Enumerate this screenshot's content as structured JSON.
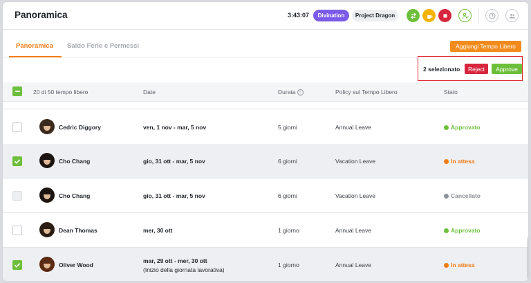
{
  "header": {
    "title": "Panoramica",
    "timer": "3:43:07",
    "pill_activity": "Divination",
    "pill_project": "Project Dragon",
    "icons": [
      "swap-icon",
      "coffee-icon",
      "stop-icon",
      "user-check-icon",
      "help-icon",
      "team-icon"
    ]
  },
  "tabs": [
    {
      "label": "Panoramica",
      "active": true
    },
    {
      "label": "Saldo Ferie e Permessi",
      "active": false
    }
  ],
  "add_button": "Aggiungi Tempo Libero",
  "selection": {
    "count_text": "2 selezionato",
    "reject": "Reject",
    "approve": "Approve"
  },
  "table": {
    "headers": {
      "count": "20 di 50 tempo libero",
      "date": "Date",
      "durata": "Durata",
      "policy": "Policy sul Tempo Libero",
      "stato": "Stato"
    },
    "rows": [
      {
        "name": "Cedric Diggory",
        "dates": "ven, 1 nov - mar, 5 nov",
        "sub": "",
        "durata": "5 giorni",
        "policy": "Annual Leave",
        "stato": "Approvato",
        "status_kind": "approved",
        "checked": false,
        "disabled": false,
        "hair": "#3b2a1d"
      },
      {
        "name": "Cho Chang",
        "dates": "gio, 31 ott - mar, 5 nov",
        "sub": "",
        "durata": "6 giorni",
        "policy": "Vacation Leave",
        "stato": "In attesa",
        "status_kind": "pending",
        "checked": true,
        "disabled": false,
        "hair": "#1c1410"
      },
      {
        "name": "Cho Chang",
        "dates": "gio, 31 ott - mar, 5 nov",
        "sub": "",
        "durata": "6 giorni",
        "policy": "Vacation Leave",
        "stato": "Cancellato",
        "status_kind": "cancel",
        "checked": false,
        "disabled": true,
        "hair": "#1c1410"
      },
      {
        "name": "Dean Thomas",
        "dates": "mer, 30 ott",
        "sub": "",
        "durata": "1 giorno",
        "policy": "Annual Leave",
        "stato": "Approvato",
        "status_kind": "approved",
        "checked": false,
        "disabled": false,
        "hair": "#2a1d14"
      },
      {
        "name": "Oliver Wood",
        "dates": "mar, 29 ott - mer, 30 ott",
        "sub": "(Inizio della giornata lavorativa)",
        "durata": "1 giorno",
        "policy": "Annual Leave",
        "stato": "In attesa",
        "status_kind": "pending",
        "checked": true,
        "disabled": false,
        "hair": "#5a2a12"
      }
    ]
  },
  "colors": {
    "accent": "#f07d16",
    "approve": "#6dbf3b",
    "reject": "#d7263d",
    "purple": "#7b5bea",
    "selection_border": "#e0232e"
  }
}
